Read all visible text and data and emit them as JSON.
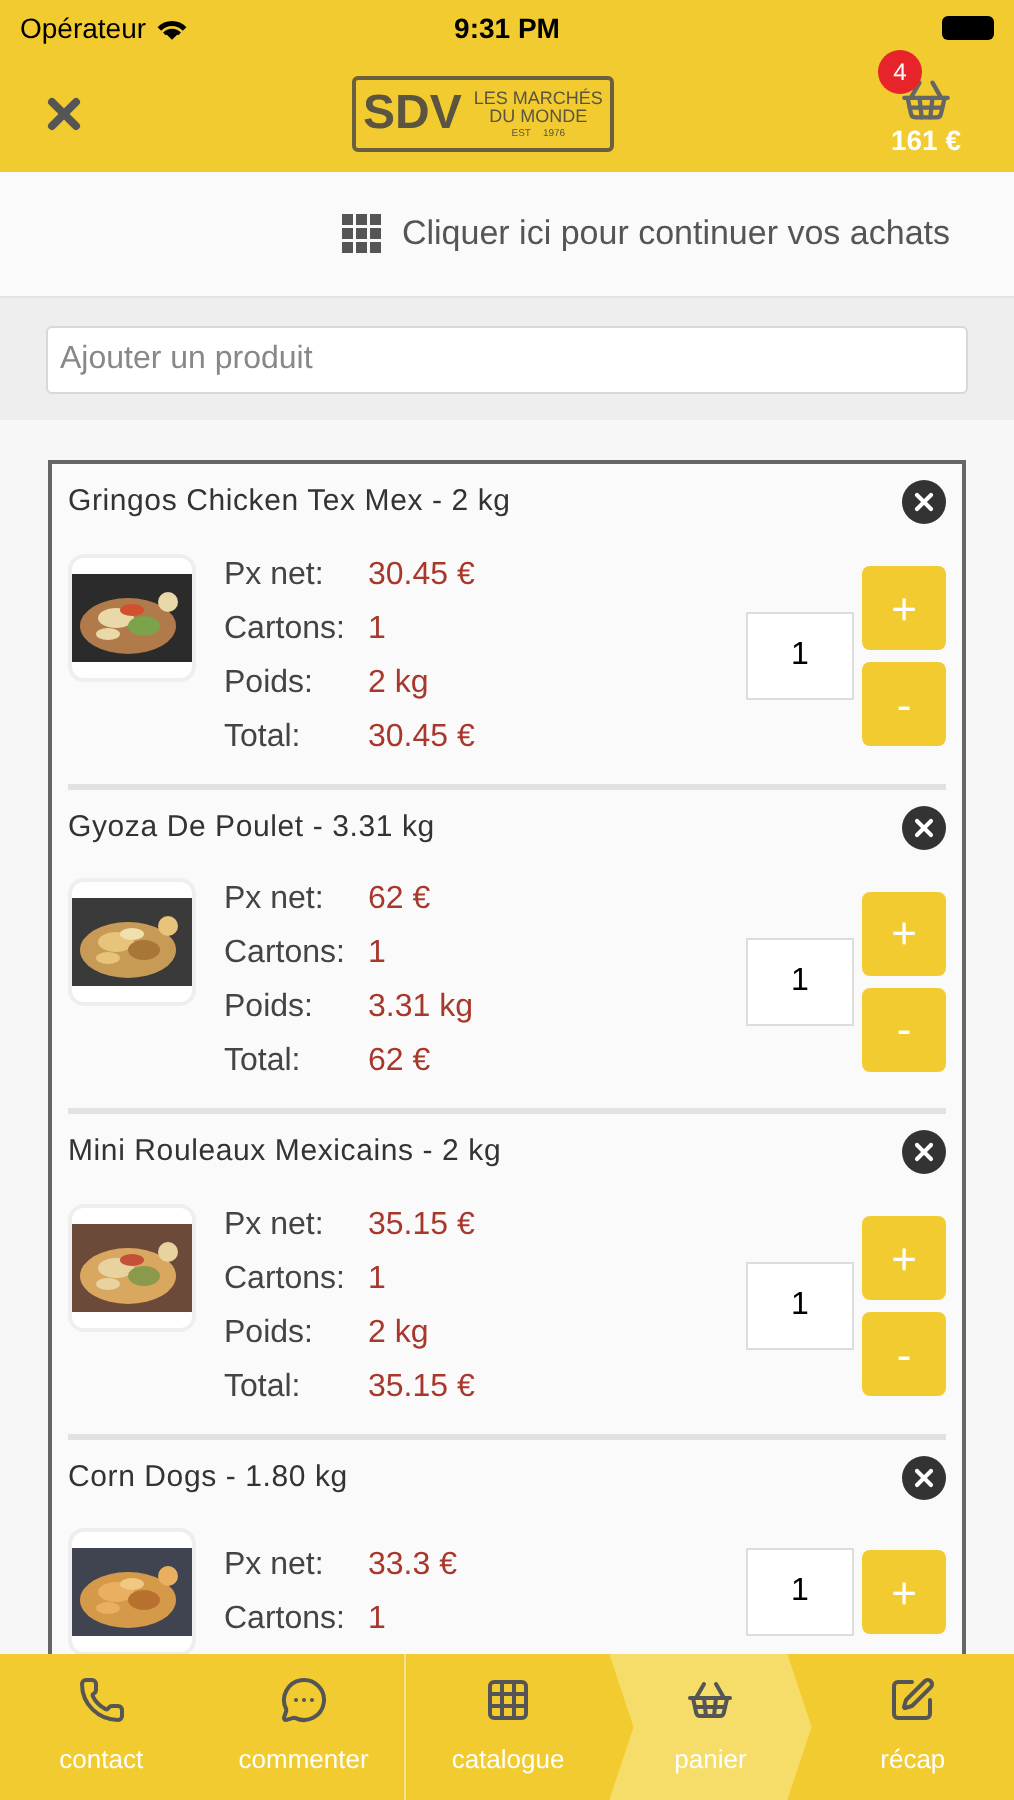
{
  "status_bar": {
    "carrier": "Opérateur",
    "time": "9:31 PM"
  },
  "header": {
    "logo": {
      "initials": "SDV",
      "line_1": "LES MARCHÉS",
      "line_2": "DU MONDE",
      "est": "EST",
      "year": "1976"
    },
    "cart_count": "4",
    "cart_total": "161 €"
  },
  "continue_link": "Cliquer ici pour continuer vos achats",
  "search": {
    "placeholder": "Ajouter un produit"
  },
  "items": [
    {
      "title": "Gringos Chicken Tex Mex - 2 kg",
      "image": {
        "kind": "picture"
      },
      "rows": [
        {
          "label": "Px net:",
          "value": "30.45 €"
        },
        {
          "label": "Cartons:",
          "value": "1"
        },
        {
          "label": "Poids:",
          "value": "2 kg"
        },
        {
          "label": "Total:",
          "value": "30.45 €"
        }
      ],
      "quantity": "1",
      "plus": "+",
      "minus": "-"
    },
    {
      "title": "Gyoza De Poulet - 3.31 kg",
      "image": {
        "kind": "picture"
      },
      "rows": [
        {
          "label": "Px net:",
          "value": "62 €"
        },
        {
          "label": "Cartons:",
          "value": "1"
        },
        {
          "label": "Poids:",
          "value": "3.31 kg"
        },
        {
          "label": "Total:",
          "value": "62 €"
        }
      ],
      "quantity": "1",
      "plus": "+",
      "minus": "-"
    },
    {
      "title": "Mini Rouleaux Mexicains - 2 kg",
      "image": {
        "kind": "picture"
      },
      "rows": [
        {
          "label": "Px net:",
          "value": "35.15 €"
        },
        {
          "label": "Cartons:",
          "value": "1"
        },
        {
          "label": "Poids:",
          "value": "2 kg"
        },
        {
          "label": "Total:",
          "value": "35.15 €"
        }
      ],
      "quantity": "1",
      "plus": "+",
      "minus": "-"
    },
    {
      "title": "Corn Dogs - 1.80 kg",
      "image": {
        "kind": "picture"
      },
      "rows": [
        {
          "label": "Px net:",
          "value": "33.3 €"
        },
        {
          "label": "Cartons:",
          "value": "1"
        }
      ],
      "quantity": "1",
      "plus": "+"
    }
  ],
  "tabs": [
    {
      "label": "contact",
      "kind": "phone",
      "selected": false
    },
    {
      "label": "commenter",
      "kind": "chat",
      "selected": false
    },
    {
      "label": "catalogue",
      "kind": "grid",
      "selected": false
    },
    {
      "label": "panier",
      "kind": "basket",
      "selected": true
    },
    {
      "label": "récap",
      "kind": "edit",
      "selected": false
    }
  ]
}
